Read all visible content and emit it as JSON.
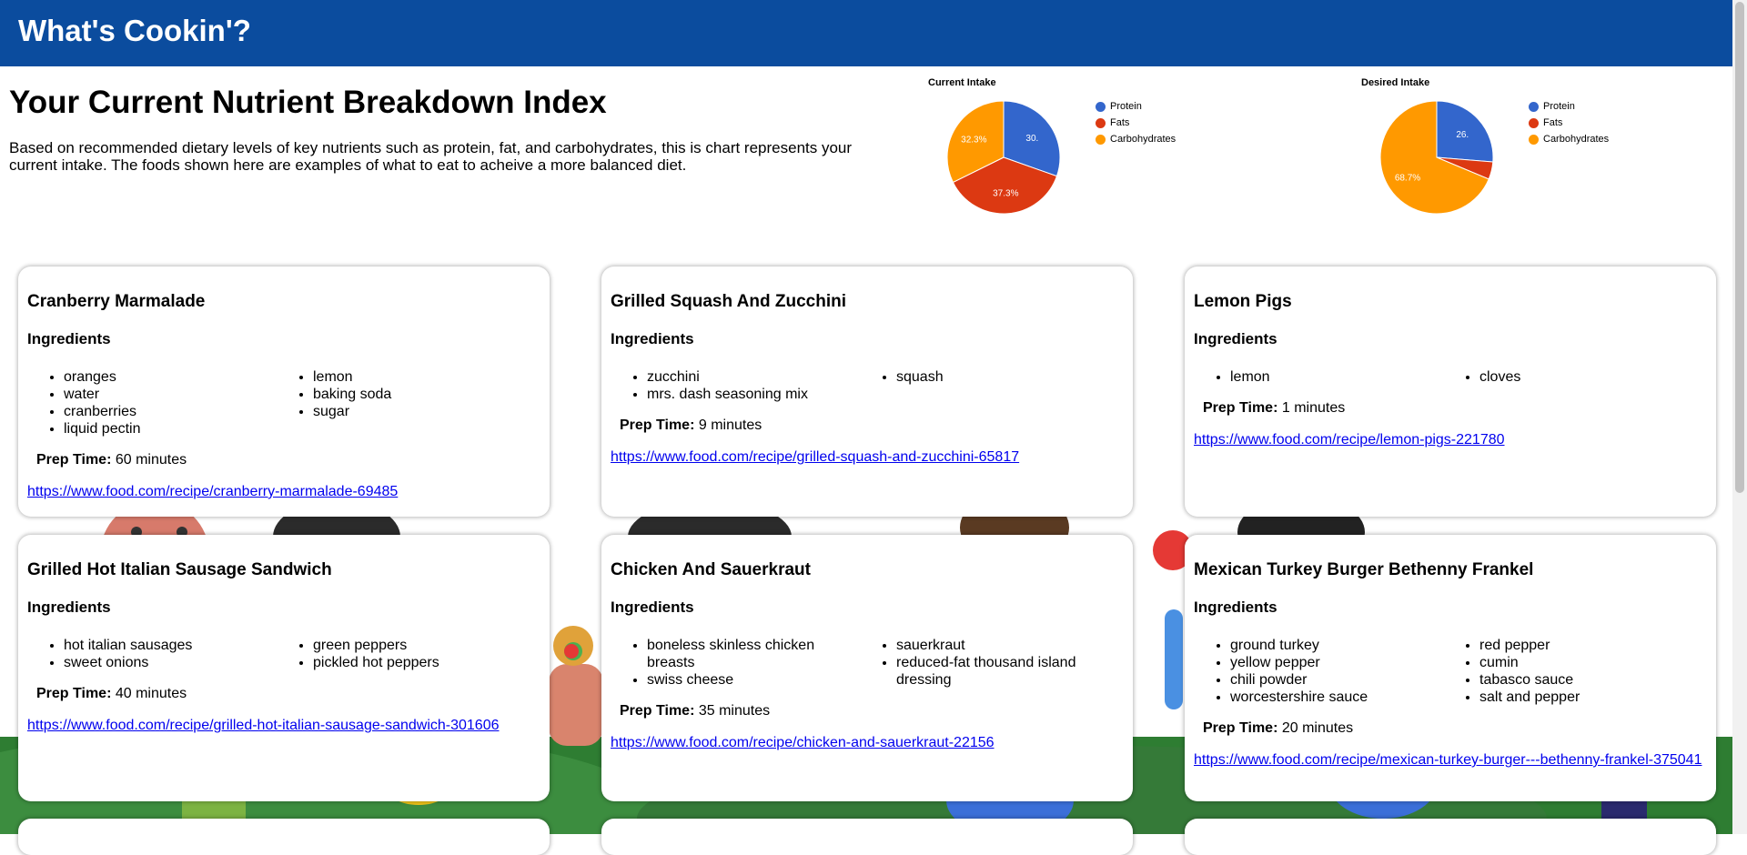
{
  "header": {
    "title": "What's Cookin'?"
  },
  "intro": {
    "title": "Your Current Nutrient Breakdown Index",
    "text": "Based on recommended dietary levels of key nutrients such as protein, fat, and carbohydrates, this is chart represents your current intake. The foods shown here are examples of what to eat to acheive a more balanced diet."
  },
  "colors": {
    "header": "#0b4c9e",
    "protein": "#3366cc",
    "fats": "#dc3912",
    "carbs": "#ff9900",
    "link": "#0000ee"
  },
  "chart_data": [
    {
      "type": "pie",
      "title": "Current Intake",
      "categories": [
        "Protein",
        "Fats",
        "Carbohydrates"
      ],
      "values": [
        30.4,
        37.3,
        32.3
      ],
      "data_labels": [
        "30.",
        "37.3%",
        "32.3%"
      ],
      "legend": "right"
    },
    {
      "type": "pie",
      "title": "Desired Intake",
      "categories": [
        "Protein",
        "Fats",
        "Carbohydrates"
      ],
      "values": [
        26.3,
        5.0,
        68.7
      ],
      "data_labels": [
        "26.",
        "",
        "68.7%"
      ],
      "legend": "right"
    }
  ],
  "labels": {
    "ingredients": "Ingredients",
    "prep_time": "Prep Time:"
  },
  "recipes": [
    {
      "title": "Cranberry Marmalade",
      "col1": [
        "oranges",
        "water",
        "cranberries",
        "liquid pectin"
      ],
      "col2": [
        "lemon",
        "baking soda",
        "sugar"
      ],
      "prep": "60 minutes",
      "url": "https://www.food.com/recipe/cranberry-marmalade-69485"
    },
    {
      "title": "Grilled Squash And Zucchini",
      "col1": [
        "zucchini",
        "mrs. dash seasoning mix"
      ],
      "col2": [
        "squash"
      ],
      "prep": "9 minutes",
      "url": "https://www.food.com/recipe/grilled-squash-and-zucchini-65817"
    },
    {
      "title": "Lemon Pigs",
      "col1": [
        "lemon"
      ],
      "col2": [
        "cloves"
      ],
      "prep": "1 minutes",
      "url": "https://www.food.com/recipe/lemon-pigs-221780"
    },
    {
      "title": "Grilled Hot Italian Sausage Sandwich",
      "col1": [
        "hot italian sausages",
        "sweet onions"
      ],
      "col2": [
        "green peppers",
        "pickled hot peppers"
      ],
      "prep": "40 minutes",
      "url": "https://www.food.com/recipe/grilled-hot-italian-sausage-sandwich-301606"
    },
    {
      "title": "Chicken And Sauerkraut",
      "col1": [
        "boneless skinless chicken breasts",
        "swiss cheese"
      ],
      "col2": [
        "sauerkraut",
        "reduced-fat thousand island dressing"
      ],
      "prep": "35 minutes",
      "url": "https://www.food.com/recipe/chicken-and-sauerkraut-22156"
    },
    {
      "title": "Mexican Turkey Burger Bethenny Frankel",
      "col1": [
        "ground turkey",
        "yellow pepper",
        "chili powder",
        "worcestershire sauce"
      ],
      "col2": [
        "red pepper",
        "cumin",
        "tabasco sauce",
        "salt and pepper"
      ],
      "prep": "20 minutes",
      "url": "https://www.food.com/recipe/mexican-turkey-burger---bethenny-frankel-375041"
    }
  ]
}
